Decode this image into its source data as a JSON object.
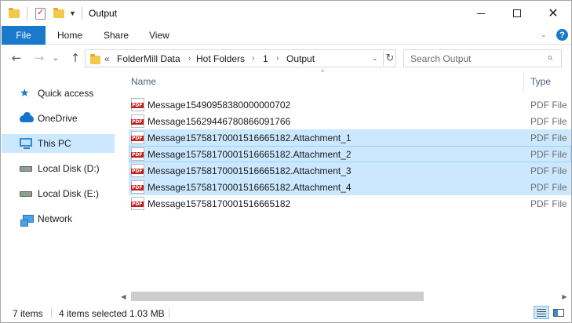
{
  "window": {
    "title": "Output",
    "controls": {
      "minimize_icon": "minimize-icon",
      "maximize_icon": "maximize-icon",
      "close_icon": "close-icon",
      "close_glyph": "✕"
    }
  },
  "ribbon": {
    "tabs": [
      {
        "label": "File",
        "active": true
      },
      {
        "label": "Home"
      },
      {
        "label": "Share"
      },
      {
        "label": "View"
      }
    ],
    "accent": "#1979ca"
  },
  "nav": {
    "back_glyph": "←",
    "forward_glyph": "→",
    "recent_glyph": "⌄",
    "up_glyph": "↑",
    "overflow": "«",
    "breadcrumbs": [
      "FolderMill Data",
      "Hot Folders",
      "1",
      "Output"
    ],
    "separator": "›",
    "refresh_glyph": "↻",
    "search_placeholder": "Search Output",
    "search_glyph": "⌕"
  },
  "sidebar": {
    "items": [
      {
        "label": "Quick access",
        "icon": "star-icon"
      },
      {
        "label": "OneDrive",
        "icon": "cloud-icon"
      },
      {
        "label": "This PC",
        "icon": "computer-icon",
        "selected": true
      },
      {
        "label": "Local Disk (D:)",
        "icon": "drive-icon"
      },
      {
        "label": "Local Disk (E:)",
        "icon": "drive-icon"
      },
      {
        "label": "Network",
        "icon": "network-icon"
      }
    ]
  },
  "list": {
    "columns": [
      "Name",
      "Type"
    ],
    "sort_glyph": "^",
    "files": [
      {
        "name": "Message15490958380000000702",
        "type": "PDF File",
        "selected": false
      },
      {
        "name": "Message15629446780866091766",
        "type": "PDF File",
        "selected": false
      },
      {
        "name": "Message15758170001516665182.Attachment_1",
        "type": "PDF File",
        "selected": true
      },
      {
        "name": "Message15758170001516665182.Attachment_2",
        "type": "PDF File",
        "selected": true,
        "focused": true
      },
      {
        "name": "Message15758170001516665182.Attachment_3",
        "type": "PDF File",
        "selected": true
      },
      {
        "name": "Message15758170001516665182.Attachment_4",
        "type": "PDF File",
        "selected": true
      },
      {
        "name": "Message15758170001516665182",
        "type": "PDF File",
        "selected": false
      }
    ],
    "file_badge": "PDF",
    "selection_color": "#cce8ff"
  },
  "scrollbar": {
    "left_glyph": "◀",
    "right_glyph": "▶"
  },
  "status": {
    "item_count": "7 items",
    "selected": "4 items selected",
    "size": "1.03 MB"
  }
}
